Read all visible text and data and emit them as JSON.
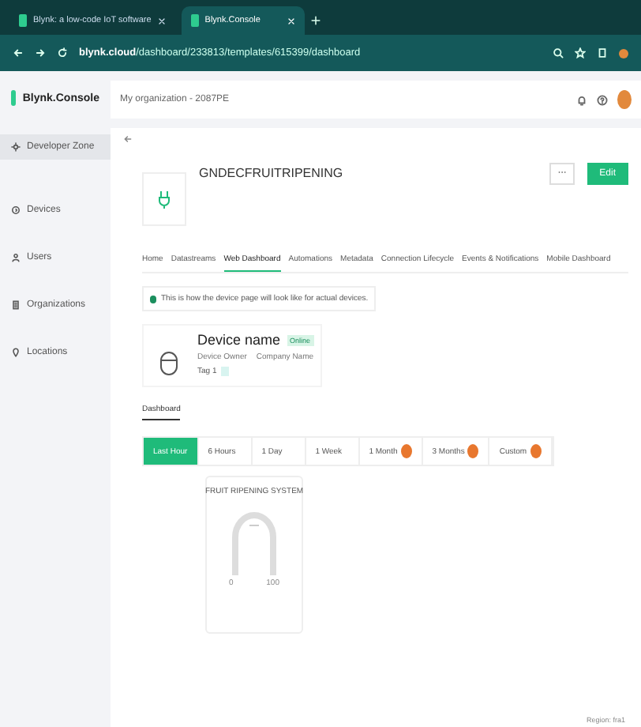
{
  "browser": {
    "tabs": [
      {
        "title": "Blynk: a low-code IoT software",
        "selected": false
      },
      {
        "title": "Blynk.Console",
        "selected": true
      }
    ],
    "url_host": "blynk.cloud",
    "url_path": "/dashboard/233813/templates/615399/dashboard"
  },
  "app": {
    "logo": "Blynk.Console",
    "organization": "My organization - 2087PE",
    "sidebar": [
      {
        "label": "Developer Zone",
        "selected": true
      },
      {
        "label": "Devices",
        "selected": false
      },
      {
        "label": "Users",
        "selected": false
      },
      {
        "label": "Organizations",
        "selected": false
      },
      {
        "label": "Locations",
        "selected": false
      }
    ]
  },
  "template": {
    "name": "GNDECFRUITRIPENING",
    "edit_button": "Edit",
    "tabs": [
      {
        "label": "Home",
        "selected": false
      },
      {
        "label": "Datastreams",
        "selected": false
      },
      {
        "label": "Web Dashboard",
        "selected": true
      },
      {
        "label": "Automations",
        "selected": false
      },
      {
        "label": "Metadata",
        "selected": false
      },
      {
        "label": "Connection Lifecycle",
        "selected": false
      },
      {
        "label": "Events & Notifications",
        "selected": false
      },
      {
        "label": "Mobile Dashboard",
        "selected": false
      }
    ]
  },
  "preview": {
    "info": "This is how the device page will look like for actual devices.",
    "device_name": "Device name",
    "status": "Online",
    "owner": "Device Owner",
    "company": "Company Name",
    "tag": "Tag 1",
    "dashboard_tab": "Dashboard",
    "time_ranges": [
      {
        "label": "Last Hour",
        "selected": true,
        "locked": false
      },
      {
        "label": "6 Hours",
        "selected": false,
        "locked": false
      },
      {
        "label": "1 Day",
        "selected": false,
        "locked": false
      },
      {
        "label": "1 Week",
        "selected": false,
        "locked": false
      },
      {
        "label": "1 Month",
        "selected": false,
        "locked": true
      },
      {
        "label": "3 Months",
        "selected": false,
        "locked": true
      },
      {
        "label": "Custom",
        "selected": false,
        "locked": true
      }
    ],
    "widget": {
      "title": "FRUIT RIPENING SYSTEM",
      "value": "—",
      "min": "0",
      "max": "100"
    }
  },
  "footer": "Region: fra1"
}
